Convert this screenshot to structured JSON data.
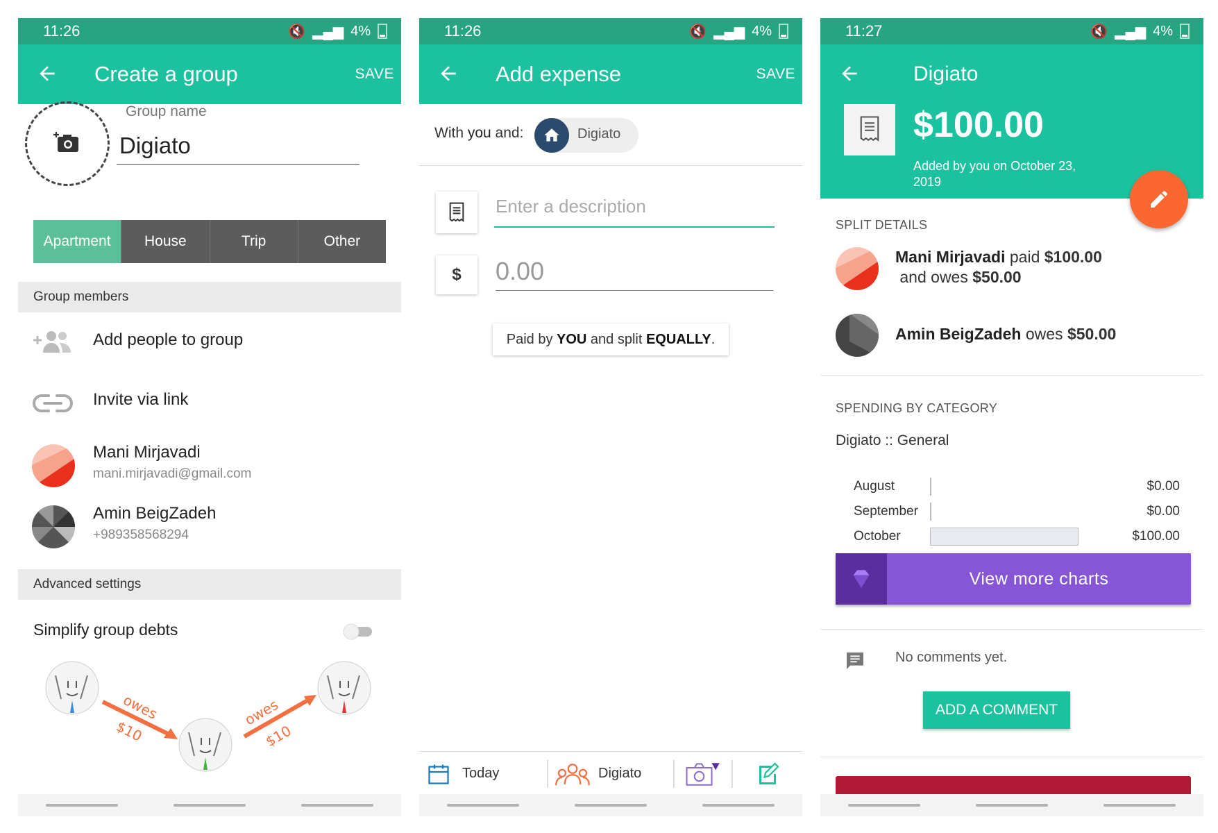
{
  "screen1": {
    "status": {
      "time": "11:26",
      "battery": "4%"
    },
    "appbar": {
      "title": "Create a group",
      "save": "SAVE"
    },
    "group_name_label": "Group name",
    "group_name_value": "Digiato",
    "types": [
      "Apartment",
      "House",
      "Trip",
      "Other"
    ],
    "members_header": "Group members",
    "add_people": "Add people to group",
    "invite_link": "Invite via link",
    "members": [
      {
        "name": "Mani Mirjavadi",
        "detail": "mani.mirjavadi@gmail.com"
      },
      {
        "name": "Amin BeigZadeh",
        "detail": "+989358568294"
      }
    ],
    "advanced_header": "Advanced settings",
    "simplify_label": "Simplify group debts",
    "simplify_enabled": false,
    "illustration": {
      "owes1": "owes",
      "amount1": "$10",
      "owes2": "owes",
      "amount2": "$10"
    }
  },
  "screen2": {
    "status": {
      "time": "11:26",
      "battery": "4%"
    },
    "appbar": {
      "title": "Add expense",
      "save": "SAVE"
    },
    "with_prefix": "With",
    "with_you": "you",
    "with_suffix": "and:",
    "group_chip": "Digiato",
    "description_placeholder": "Enter a description",
    "currency": "$",
    "amount_placeholder": "0.00",
    "paid_by": {
      "p1": "Paid by ",
      "who": "YOU",
      "p2": " and split ",
      "how": "EQUALLY",
      "p3": "."
    },
    "bottom": {
      "date": "Today",
      "group": "Digiato"
    }
  },
  "screen3": {
    "status": {
      "time": "11:27",
      "battery": "4%"
    },
    "appbar": {
      "title": "Digiato"
    },
    "amount": "$100.00",
    "added_by": "Added by you on October 23, 2019",
    "split_header": "SPLIT DETAILS",
    "split": [
      {
        "name": "Mani Mirjavadi",
        "mid": " paid ",
        "paid": "$100.00",
        "and": " and owes ",
        "owes": "$50.00"
      },
      {
        "name": "Amin BeigZadeh",
        "mid": " owes ",
        "owes": "$50.00"
      }
    ],
    "spending_header": "SPENDING BY CATEGORY",
    "spending_category": "Digiato :: General",
    "spending": [
      {
        "month": "August",
        "value": "$0.00",
        "fraction": 0
      },
      {
        "month": "September",
        "value": "$0.00",
        "fraction": 0
      },
      {
        "month": "October",
        "value": "$100.00",
        "fraction": 1
      }
    ],
    "view_more": "View more charts",
    "no_comments": "No comments yet.",
    "add_comment": "ADD A COMMENT"
  },
  "colors": {
    "primary": "#1cc29f",
    "status": "#27a582",
    "accent": "#fa6730",
    "purple": "#8656d6",
    "segment_active": "#5bbf99"
  }
}
